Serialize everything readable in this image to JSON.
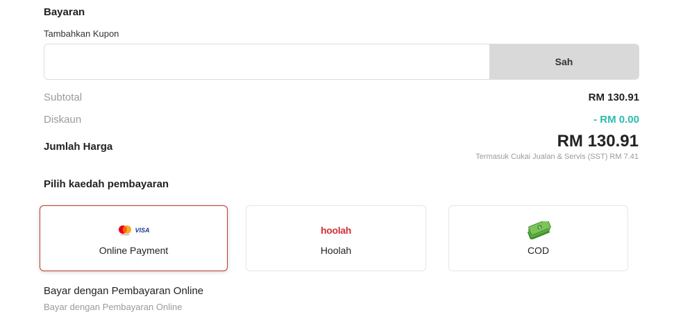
{
  "payment": {
    "section_title": "Bayaran",
    "coupon_label": "Tambahkan Kupon",
    "coupon_value": "",
    "coupon_placeholder": "",
    "coupon_button": "Sah"
  },
  "summary": {
    "subtotal_label": "Subtotal",
    "subtotal_value": "RM 130.91",
    "discount_label": "Diskaun",
    "discount_value": "- RM 0.00",
    "total_label": "Jumlah Harga",
    "total_value": "RM 130.91",
    "tax_note": "Termasuk Cukai Jualan & Servis (SST) RM 7.41"
  },
  "methods": {
    "title": "Pilih kaedah pembayaran",
    "options": [
      {
        "label": "Online Payment",
        "icon": "mastercard-visa-icon",
        "selected": true
      },
      {
        "label": "Hoolah",
        "icon": "hoolah-logo-icon",
        "logo_text": "hoolah",
        "selected": false
      },
      {
        "label": "COD",
        "icon": "cash-icon",
        "selected": false
      }
    ],
    "card_logo_text": "VISA",
    "description_title": "Bayar dengan Pembayaran Online",
    "description_sub": "Bayar dengan Pembayaran Online"
  },
  "colors": {
    "accent_selected_border": "#c0392b",
    "discount_teal": "#2bbbad",
    "hoolah_red": "#d0323a",
    "button_gray": "#d9d9d9"
  }
}
